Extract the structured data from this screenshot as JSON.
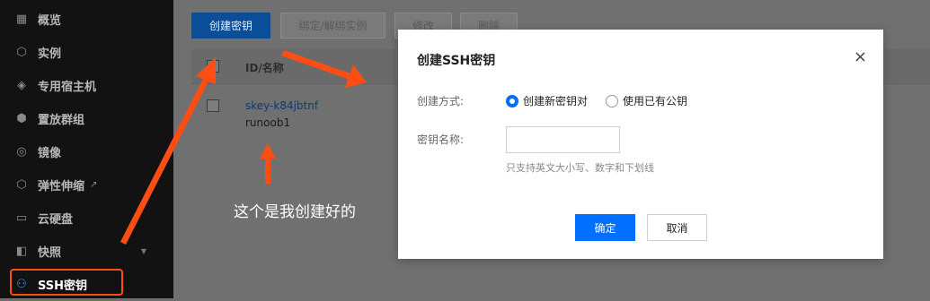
{
  "sidebar": {
    "items": [
      {
        "label": "概览",
        "icon": "grid-icon"
      },
      {
        "label": "实例",
        "icon": "cube-icon"
      },
      {
        "label": "专用宿主机",
        "icon": "layers-icon"
      },
      {
        "label": "置放群组",
        "icon": "group-icon"
      },
      {
        "label": "镜像",
        "icon": "disc-icon"
      },
      {
        "label": "弹性伸缩",
        "icon": "scaling-icon"
      },
      {
        "label": "云硬盘",
        "icon": "disk-icon"
      },
      {
        "label": "快照",
        "icon": "snapshot-icon"
      },
      {
        "label": "SSH密钥",
        "icon": "key-icon"
      }
    ]
  },
  "toolbar": {
    "create_label": "创建密钥",
    "bind_label": "绑定/解绑实例",
    "edit_label": "修改",
    "delete_label": "删除"
  },
  "table": {
    "header_id": "ID/名称",
    "rows": [
      {
        "id": "skey-k84jbtnf",
        "name": "runoob1"
      }
    ]
  },
  "annotation": {
    "note": "这个是我创建好的",
    "accent": "#ff4d14"
  },
  "modal": {
    "title": "创建SSH密钥",
    "method_label": "创建方式:",
    "option_new": "创建新密钥对",
    "option_existing": "使用已有公钥",
    "name_label": "密钥名称:",
    "name_value": "",
    "hint": "只支持英文大小写、数字和下划线",
    "ok_label": "确定",
    "cancel_label": "取消",
    "primary_color": "#006eff"
  }
}
